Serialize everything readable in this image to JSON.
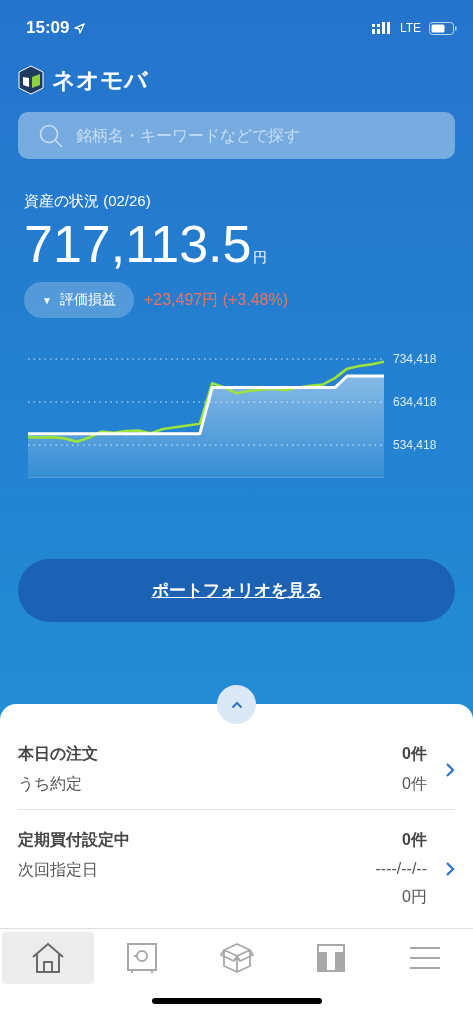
{
  "status_bar": {
    "time": "15:09",
    "network": "LTE"
  },
  "app": {
    "name": "ネオモバ"
  },
  "search": {
    "placeholder": "銘柄名・キーワードなどで探す"
  },
  "assets": {
    "label": "資産の状況 (02/26)",
    "amount": "717,113.5",
    "unit": "円",
    "toggle": {
      "icon": "▼",
      "label": "評価損益"
    },
    "gain": "+23,497円 (+3.48%)",
    "chart_data": {
      "type": "area",
      "ylim": [
        458000,
        734418
      ],
      "grid": true,
      "yticks": [
        {
          "value": 534418,
          "label": "534,418"
        },
        {
          "value": 634418,
          "label": "634,418"
        },
        {
          "value": 734418,
          "label": "734,418"
        }
      ],
      "series": [
        {
          "type": "line",
          "color": "#9be23a",
          "values": [
            553000,
            552000,
            553000,
            550000,
            542000,
            552000,
            566000,
            563000,
            567000,
            568000,
            562000,
            572000,
            576000,
            580000,
            584000,
            678000,
            668000,
            655000,
            660000,
            663000,
            665000,
            662000,
            668000,
            672000,
            675000,
            690000,
            712000,
            718000,
            722000,
            728000
          ]
        },
        {
          "color": "#ffffff",
          "values": [
            561000,
            561000,
            561000,
            561000,
            561000,
            561000,
            561000,
            561000,
            561000,
            561000,
            561000,
            561000,
            561000,
            561000,
            561000,
            668000,
            668000,
            668000,
            668000,
            668000,
            668000,
            668000,
            668000,
            668000,
            668000,
            668000,
            695000,
            695000,
            695000,
            695000
          ]
        }
      ]
    }
  },
  "portfolio_button": "ポートフォリオを見る",
  "rows": [
    {
      "title": "本日の注文",
      "title_value": "0件",
      "detail_label": "うち約定",
      "detail_values": [
        "0件"
      ]
    },
    {
      "title": "定期買付設定中",
      "title_value": "0件",
      "detail_label": "次回指定日",
      "detail_values": [
        "----/--/--",
        "0円"
      ]
    }
  ],
  "tabs": [
    {
      "kind": "home",
      "selected": true
    },
    {
      "kind": "safe",
      "selected": false
    },
    {
      "kind": "box",
      "selected": false
    },
    {
      "kind": "tile",
      "selected": false
    },
    {
      "kind": "menu",
      "selected": false
    }
  ]
}
